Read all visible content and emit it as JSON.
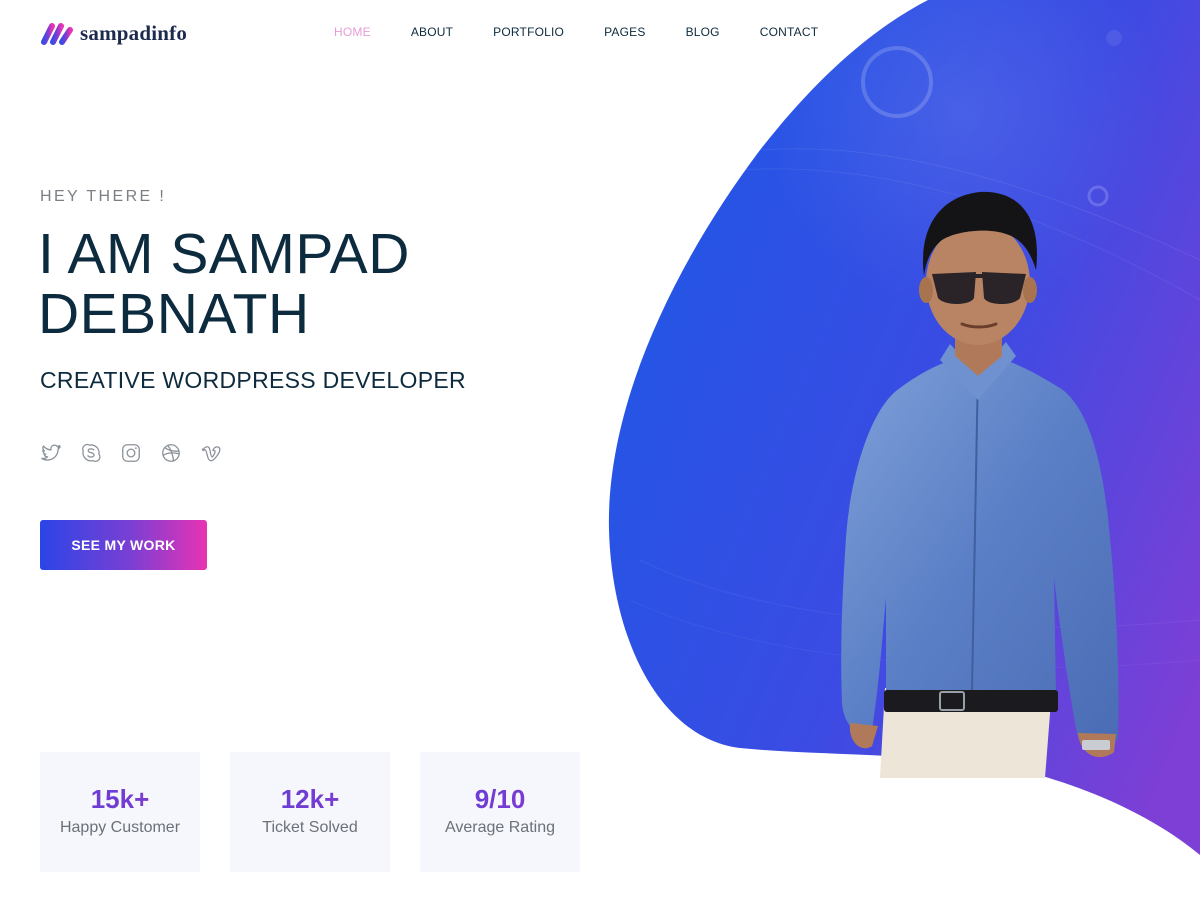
{
  "brand": {
    "name": "sampadinfo"
  },
  "nav": {
    "items": [
      {
        "label": "HOME",
        "active": true
      },
      {
        "label": "ABOUT",
        "active": false
      },
      {
        "label": "PORTFOLIO",
        "active": false
      },
      {
        "label": "PAGES",
        "active": false
      },
      {
        "label": "BLOG",
        "active": false
      },
      {
        "label": "CONTACT",
        "active": false
      }
    ],
    "active_color": "#e89bd9",
    "text_color": "#0d2b3e"
  },
  "hero": {
    "eyebrow": "HEY THERE !",
    "title": "I AM SAMPAD DEBNATH",
    "subtitle": "CREATIVE WORDPRESS DEVELOPER",
    "cta_label": "SEE MY WORK",
    "socials": [
      {
        "icon": "twitter-icon"
      },
      {
        "icon": "skype-icon"
      },
      {
        "icon": "instagram-icon"
      },
      {
        "icon": "dribbble-icon"
      },
      {
        "icon": "vimeo-icon"
      }
    ]
  },
  "stats": [
    {
      "value": "15k+",
      "label": "Happy Customer"
    },
    {
      "value": "12k+",
      "label": "Ticket Solved"
    },
    {
      "value": "9/10",
      "label": "Average Rating"
    }
  ],
  "colors": {
    "blob_start": "#1f57e6",
    "blob_end": "#7d3fd6",
    "cta_start": "#2b45e6",
    "cta_end": "#e833b3",
    "heading": "#0d2b3e"
  }
}
